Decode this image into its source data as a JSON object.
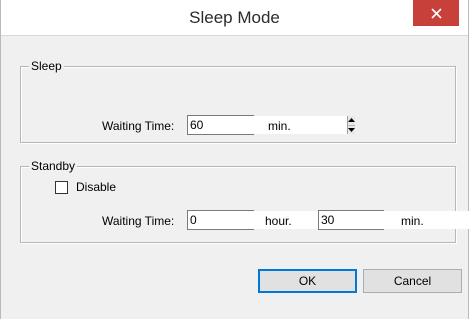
{
  "window": {
    "title": "Sleep Mode"
  },
  "icons": {
    "close": "close-icon",
    "spin_up": "arrow-up-icon",
    "spin_down": "arrow-down-icon"
  },
  "colors": {
    "close_button": "#c7403a",
    "default_button_border": "#0078d7"
  },
  "sleep": {
    "group_label": "Sleep",
    "waiting_label": "Waiting Time:",
    "waiting_value": "60",
    "unit": "min."
  },
  "standby": {
    "group_label": "Standby",
    "disable_label": "Disable",
    "disable_checked": false,
    "waiting_label": "Waiting Time:",
    "hours_value": "0",
    "hours_unit": "hour.",
    "minutes_value": "30",
    "minutes_unit": "min."
  },
  "buttons": {
    "ok": "OK",
    "cancel": "Cancel"
  }
}
